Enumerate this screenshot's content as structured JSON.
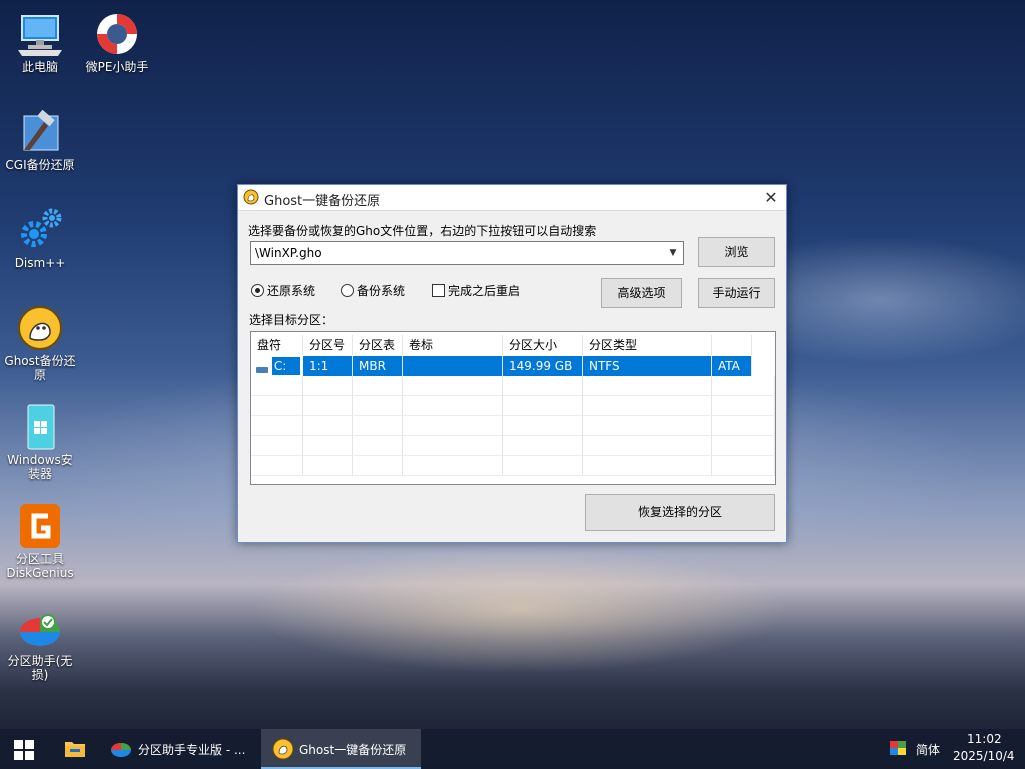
{
  "desktop": {
    "icons": [
      {
        "label": "此电脑"
      },
      {
        "label": "微PE小助手"
      },
      {
        "label": "CGI备份还原"
      },
      {
        "label": "Dism++"
      },
      {
        "label": "Ghost备份还原"
      },
      {
        "label": "Windows安装器"
      },
      {
        "label": "分区工具DiskGenius"
      },
      {
        "label": "分区助手(无损)"
      }
    ]
  },
  "dialog": {
    "title": "Ghost一键备份还原",
    "close_glyph": "✕",
    "instruction": "选择要备份或恢复的Gho文件位置，右边的下拉按钮可以自动搜索",
    "path_value": "\\WinXP.gho",
    "browse_label": "浏览",
    "radio_restore": "还原系统",
    "radio_backup": "备份系统",
    "selected_mode": "还原系统",
    "reboot_label": "完成之后重启",
    "reboot_checked": false,
    "advanced_label": "高级选项",
    "manual_label": "手动运行",
    "target_label": "选择目标分区：",
    "table": {
      "columns": [
        "盘符",
        "分区号",
        "分区表",
        "卷标",
        "分区大小",
        "分区类型",
        ""
      ],
      "rows": [
        {
          "drive": "C:",
          "partition": "1:1",
          "table": "MBR",
          "volume": "",
          "size": "149.99 GB",
          "fs": "NTFS",
          "bus": "ATA"
        }
      ]
    },
    "restore_partition_label": "恢复选择的分区"
  },
  "taskbar": {
    "items": [
      {
        "label": "分区助手专业版 - ..."
      },
      {
        "label": "Ghost一键备份还原"
      }
    ],
    "ime": "简体",
    "time": "11:02",
    "date": "2025/10/4"
  },
  "colors": {
    "accent": "#0078d7",
    "taskbar": "#141c30"
  }
}
